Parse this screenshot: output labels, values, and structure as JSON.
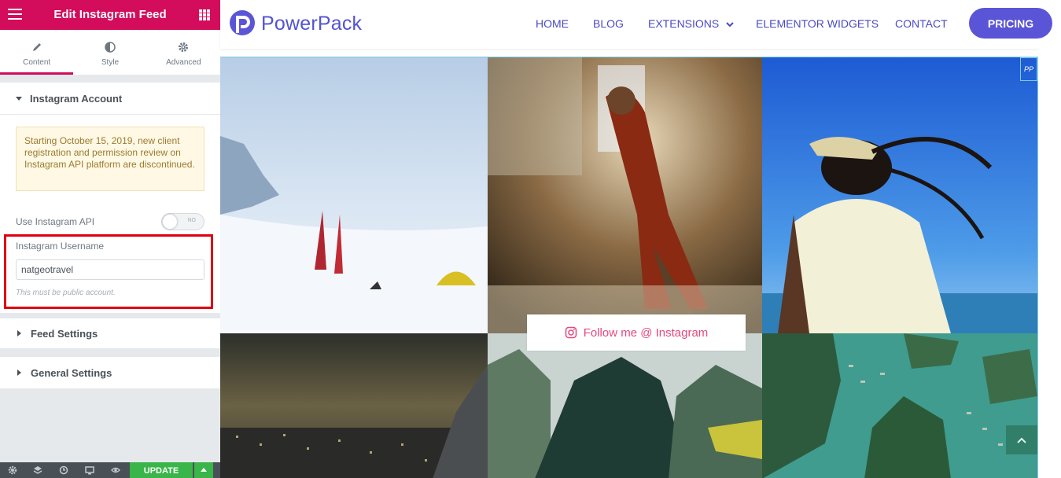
{
  "panel": {
    "title": "Edit Instagram Feed",
    "tabs": [
      {
        "label": "Content",
        "icon": "pencil-icon"
      },
      {
        "label": "Style",
        "icon": "half-circle-icon"
      },
      {
        "label": "Advanced",
        "icon": "gear-icon"
      }
    ],
    "sections": {
      "instagram_account": "Instagram Account",
      "feed_settings": "Feed Settings",
      "general_settings": "General Settings"
    },
    "notice": "Starting October 15, 2019, new client registration and permission review on Instagram API platform are discontinued.",
    "use_api": {
      "label": "Use Instagram API",
      "state": "NO"
    },
    "username": {
      "label": "Instagram Username",
      "value": "natgeotravel",
      "help": "This must be public account."
    },
    "footer": {
      "update_label": "UPDATE",
      "accent": "#39b54a"
    }
  },
  "site": {
    "logo_text": "PowerPack",
    "nav": [
      "HOME",
      "BLOG",
      "EXTENSIONS",
      "ELEMENTOR WIDGETS",
      "CONTACT"
    ],
    "pricing": "PRICING",
    "brand_color": "#5a55d6",
    "follow_label": "Follow me @ Instagram",
    "badge": "PP"
  },
  "colors": {
    "panel_accent": "#d30c5c",
    "highlight": "#e0000f"
  }
}
